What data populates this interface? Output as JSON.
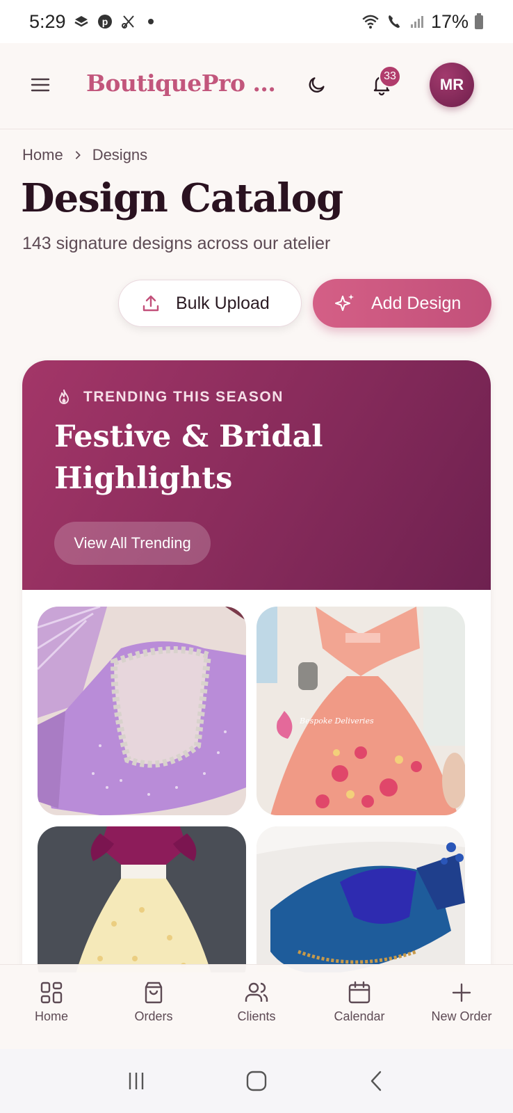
{
  "status_bar": {
    "time": "5:29",
    "battery": "17%"
  },
  "header": {
    "brand": "BoutiquePro ...",
    "notification_count": "33",
    "avatar_initials": "MR"
  },
  "breadcrumb": {
    "home": "Home",
    "current": "Designs"
  },
  "page": {
    "title": "Design Catalog",
    "subtitle": "143 signature designs across our atelier"
  },
  "actions": {
    "bulk_upload": "Bulk Upload",
    "add_design": "Add Design"
  },
  "trending": {
    "eyebrow": "TRENDING THIS SEASON",
    "title": "Festive & Bridal Highlights",
    "cta": "View All Trending"
  },
  "gallery": {
    "watermark": "Bespoke Deliveries"
  },
  "bottom_nav": {
    "items": [
      {
        "label": "Home",
        "icon": "grid-icon"
      },
      {
        "label": "Orders",
        "icon": "shopping-bag-icon"
      },
      {
        "label": "Clients",
        "icon": "users-icon"
      },
      {
        "label": "Calendar",
        "icon": "calendar-icon"
      },
      {
        "label": "New Order",
        "icon": "plus-icon"
      }
    ]
  },
  "colors": {
    "accent": "#c2567c",
    "hero_start": "#a33668",
    "hero_end": "#6e2150",
    "background": "#fbf7f5"
  }
}
